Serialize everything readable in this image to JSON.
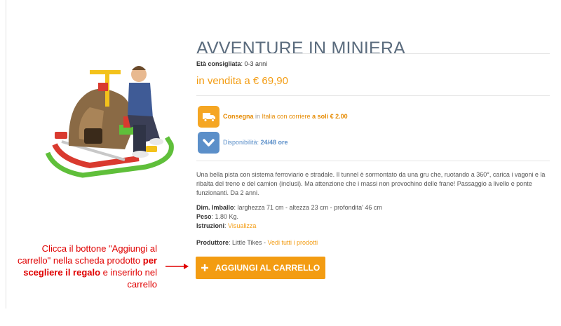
{
  "product": {
    "title": "AVVENTURE IN MINIERA",
    "age_label": "Età consigliata",
    "age_value": "0-3 anni",
    "price": "in vendita a € 69,90"
  },
  "features": {
    "delivery": {
      "icon": "delivery-truck-icon",
      "part1": "Consegna",
      "part2": " in ",
      "part3": "Italia con corriere",
      "part4": " a soli € 2.00"
    },
    "availability": {
      "icon": "chevron-down-icon",
      "label": "Disponibilità: ",
      "value": "24/48 ore"
    }
  },
  "description": "Una bella pista con sistema ferroviario e stradale. Il tunnel è sormontato da una gru che, ruotando a 360°, carica i vagoni e la ribalta del treno e del camion (inclusi). Ma attenzione che i massi non provochino delle frane! Passaggio a livello e ponte funzionanti. Da 2 anni.",
  "specs": {
    "dimensions_label": "Dim. Imballo",
    "dimensions_value": ": larghezza 71 cm - altezza 23 cm - profondita' 46 cm",
    "weight_label": "Peso",
    "weight_value": ": 1.80 Kg.",
    "instructions_label": "Istruzioni",
    "instructions_colon": ": ",
    "instructions_link": "Visualizza"
  },
  "producer": {
    "label": "Produttore",
    "value": ": Little Tikes - ",
    "link": "Vedi tutti i prodotti"
  },
  "cart_button": {
    "icon": "plus-icon",
    "label": "AGGIUNGI AL CARRELLO"
  },
  "callout": {
    "text1": "Clicca il bottone \"Aggiungi al carrello\" nella scheda prodotto ",
    "bold": "per scegliere il regalo",
    "text2": " e inserirlo nel carrello"
  },
  "colors": {
    "accent": "#f39c12",
    "title": "#5a6b7d",
    "blue": "#5b8fc9",
    "callout": "#e00000"
  }
}
